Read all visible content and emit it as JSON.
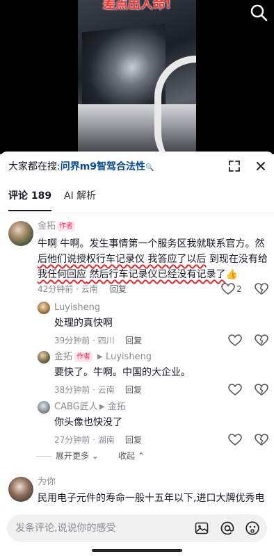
{
  "video": {
    "caption": "差点出人命!"
  },
  "panel": {
    "search_prefix": "大家都在搜:",
    "search_query": "问界m9智驾合法性",
    "tabs": [
      {
        "label": "评论 189"
      },
      {
        "label": "AI 解析"
      }
    ]
  },
  "comments": [
    {
      "author": "金拓",
      "badge": "作者",
      "text_parts": [
        "牛啊 牛啊。发生事情第一个服务区我就联系官方。然",
        "后他们说授权行车记录仪 我答应了以后",
        " 到现在没有给",
        "我任何回应",
        " 然后行车记录仪已经没有记录了",
        "👍"
      ],
      "meta": "42分钟前 · 云南",
      "reply": "回复",
      "likes": "2"
    },
    {
      "author": "Luyisheng",
      "text": "处理的真快啊",
      "meta": "39分钟前 · 四川",
      "reply": "回复"
    },
    {
      "author": "金拓",
      "badge": "作者",
      "reply_to": "Luyisheng",
      "text": "要快了。牛啊。中国的大企业。",
      "meta": "38分钟前 · 云南",
      "reply": "回复"
    },
    {
      "author": "CABG匠人",
      "reply_to": "金拓",
      "text": "你头像也快没了",
      "meta": "27分钟前 · 湖南",
      "reply": "回复"
    },
    {
      "author": "为你",
      "text": "民用电子元件的寿命一般十五年以下,进口大牌优秀电"
    }
  ],
  "thread_controls": {
    "expand_more": "展开更多",
    "collapse": "收起"
  },
  "input": {
    "placeholder": "发条评论,说说你的感受"
  }
}
